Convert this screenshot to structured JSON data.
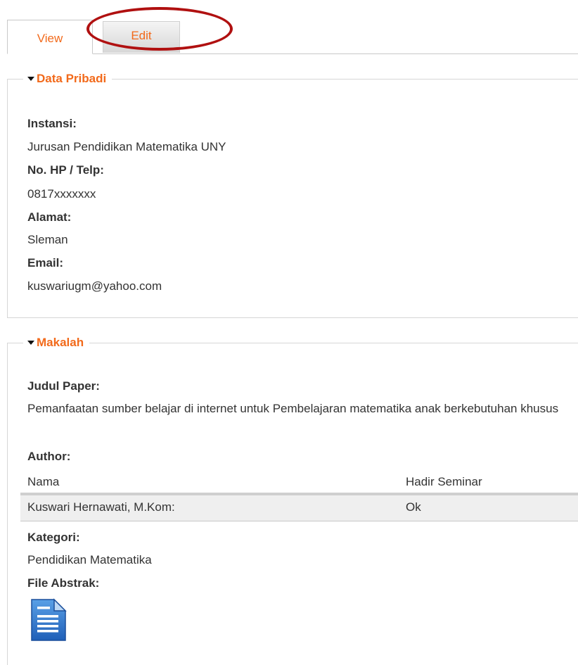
{
  "tabs": {
    "view": "View",
    "edit": "Edit"
  },
  "data_pribadi": {
    "legend": "Data Pribadi",
    "instansi_label": "Instansi:",
    "instansi_value": "Jurusan Pendidikan Matematika UNY",
    "hp_label": "No. HP / Telp:",
    "hp_value": "0817xxxxxxx",
    "alamat_label": "Alamat:",
    "alamat_value": "Sleman",
    "email_label": "Email:",
    "email_value": "kuswariugm@yahoo.com"
  },
  "makalah": {
    "legend": "Makalah",
    "judul_label": "Judul Paper:",
    "judul_value": "Pemanfaatan sumber belajar di internet untuk Pembelajaran matematika anak berkebutuhan khusus",
    "author_label": "Author:",
    "author_table": {
      "headers": [
        "Nama",
        "Hadir Seminar"
      ],
      "rows": [
        [
          "Kuswari Hernawati, M.Kom:",
          "Ok"
        ]
      ]
    },
    "kategori_label": "Kategori:",
    "kategori_value": "Pendidikan Matematika",
    "file_label": "File Abstrak:",
    "file_icon": "document-icon"
  },
  "colors": {
    "accent": "#f26a1b",
    "highlight": "#b01010"
  }
}
